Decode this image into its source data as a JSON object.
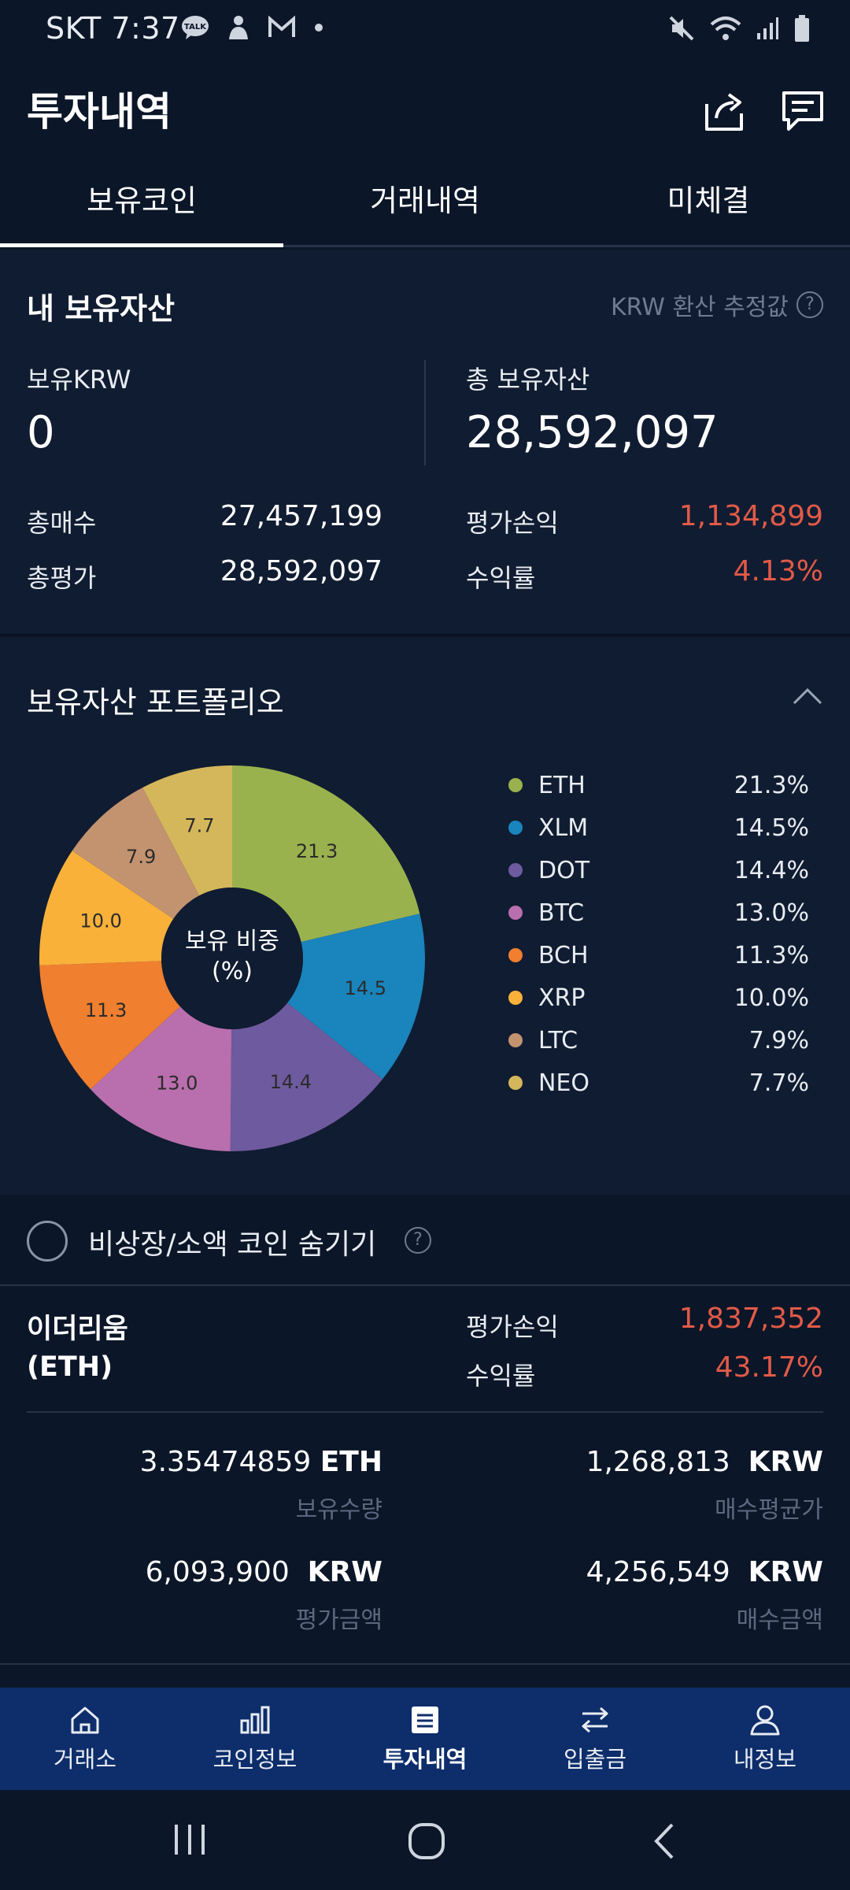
{
  "status_bar": {
    "time": "SKT 7:37",
    "icons": [
      "talk-icon",
      "person-icon",
      "mail-icon",
      "dot-icon",
      "mute-icon",
      "wifi-icon",
      "signal-icon",
      "battery-icon"
    ]
  },
  "header": {
    "title": "투자내역",
    "share_icon": "share-icon",
    "chat_icon": "chat-icon"
  },
  "tabs": [
    {
      "label": "보유코인",
      "active": true
    },
    {
      "label": "거래내역",
      "active": false
    },
    {
      "label": "미체결",
      "active": false
    }
  ],
  "assets": {
    "title": "내 보유자산",
    "estimate_note": "KRW 환산 추정값",
    "krw_label": "보유KRW",
    "krw_value": "0",
    "total_label": "총 보유자산",
    "total_value": "28,592,097",
    "buy_total_label": "총매수",
    "buy_total_value": "27,457,199",
    "eval_total_label": "총평가",
    "eval_total_value": "28,592,097",
    "pnl_label": "평가손익",
    "pnl_value": "1,134,899",
    "return_label": "수익률",
    "return_value": "4.13%"
  },
  "portfolio": {
    "title": "보유자산 포트폴리오",
    "center_label_line1": "보유 비중",
    "center_label_line2": "(%)",
    "collapse_icon": "chevron-up-icon"
  },
  "chart_data": {
    "type": "pie",
    "title": "보유 비중 (%)",
    "categories": [
      "ETH",
      "XLM",
      "DOT",
      "BTC",
      "BCH",
      "XRP",
      "LTC",
      "NEO"
    ],
    "values": [
      21.3,
      14.5,
      14.4,
      13.0,
      11.3,
      10.0,
      7.9,
      7.7
    ],
    "labels": [
      "21.3",
      "14.5",
      "14.4",
      "13.0",
      "11.3",
      "10.0",
      "7.9",
      "7.7"
    ],
    "legend_values": [
      "21.3%",
      "14.5%",
      "14.4%",
      "13.0%",
      "11.3%",
      "10.0%",
      "7.9%",
      "7.7%"
    ],
    "colors": [
      "#9ab24d",
      "#1a84bc",
      "#6e5a9e",
      "#b96fad",
      "#f07f2f",
      "#f9b13a",
      "#c39370",
      "#d4b75b"
    ],
    "donut": true,
    "legend_position": "right"
  },
  "hide_toggle": {
    "label": "비상장/소액 코인 숨기기",
    "checked": false
  },
  "coin": {
    "name_line1": "이더리움",
    "name_line2": "(ETH)",
    "pnl_label": "평가손익",
    "pnl_value": "1,837,352",
    "return_label": "수익률",
    "return_value": "43.17%",
    "quantity": "3.35474859",
    "quantity_unit": "ETH",
    "quantity_label": "보유수량",
    "avg_price": "1,268,813",
    "avg_price_unit": "KRW",
    "avg_price_label": "매수평균가",
    "eval_amount": "6,093,900",
    "eval_amount_unit": "KRW",
    "eval_amount_label": "평가금액",
    "buy_amount": "4,256,549",
    "buy_amount_unit": "KRW",
    "buy_amount_label": "매수금액"
  },
  "bottom_nav": [
    {
      "label": "거래소",
      "icon": "home-icon",
      "active": false
    },
    {
      "label": "코인정보",
      "icon": "chart-icon",
      "active": false
    },
    {
      "label": "투자내역",
      "icon": "list-icon",
      "active": true
    },
    {
      "label": "입출금",
      "icon": "transfer-icon",
      "active": false
    },
    {
      "label": "내정보",
      "icon": "user-icon",
      "active": false
    }
  ],
  "system_nav": [
    "recents-icon",
    "home-circle-icon",
    "back-icon"
  ],
  "colors": {
    "background": "#0b1628",
    "panel": "#101c31",
    "positive": "#e25a48",
    "nav_bar": "#0d2d6b"
  }
}
